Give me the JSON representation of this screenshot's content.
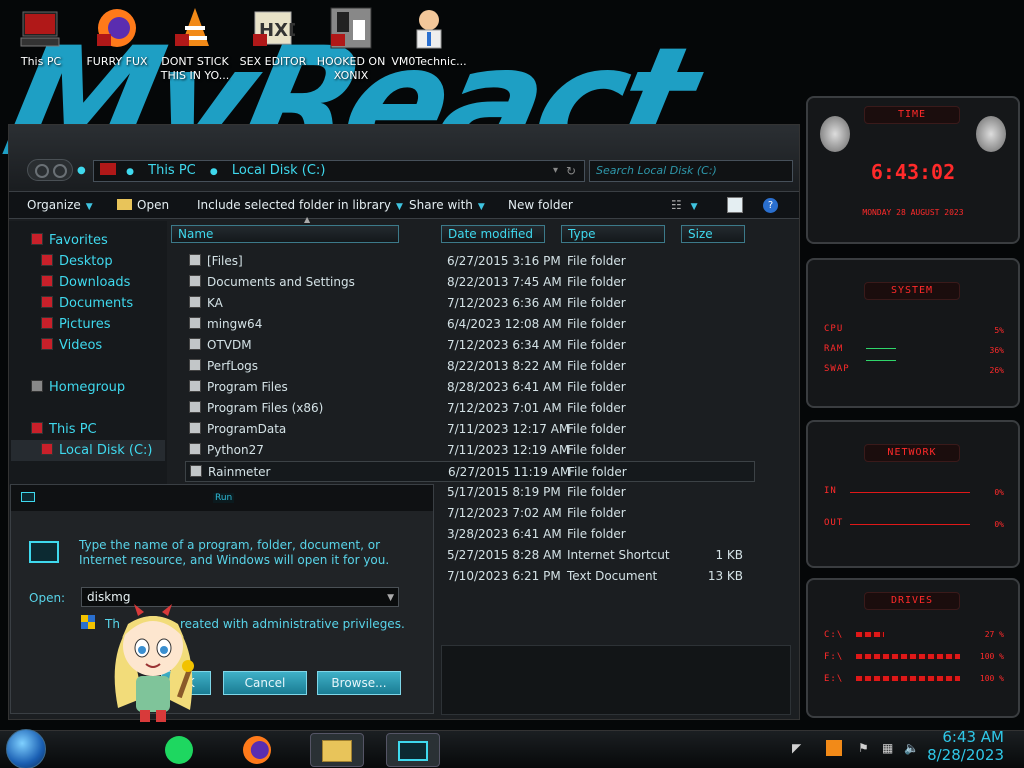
{
  "desktop": {
    "icons": [
      {
        "label": "This PC"
      },
      {
        "label": "FURRY FUX"
      },
      {
        "label": "DONT STICK THIS IN YO..."
      },
      {
        "label": "SEX EDITOR"
      },
      {
        "label": "HOOKED ON XONIX"
      },
      {
        "label": "VM0Technic..."
      }
    ]
  },
  "explorer": {
    "breadcrumb": [
      "This PC",
      "Local Disk (C:)"
    ],
    "search_placeholder": "Search Local Disk (C:)",
    "toolbar": {
      "organize": "Organize",
      "open": "Open",
      "include": "Include selected folder in library",
      "share": "Share with",
      "new_folder": "New folder"
    },
    "nav": {
      "favorites": "Favorites",
      "desktop": "Desktop",
      "downloads": "Downloads",
      "documents": "Documents",
      "pictures": "Pictures",
      "videos": "Videos",
      "homegroup": "Homegroup",
      "this_pc": "This PC",
      "local_disk": "Local Disk (C:)"
    },
    "columns": {
      "name": "Name",
      "date": "Date modified",
      "type": "Type",
      "size": "Size"
    },
    "rows": [
      {
        "name": "[Files]",
        "date": "6/27/2015 3:16 PM",
        "type": "File folder",
        "size": ""
      },
      {
        "name": "Documents and Settings",
        "date": "8/22/2013 7:45 AM",
        "type": "File folder",
        "size": ""
      },
      {
        "name": "KA",
        "date": "7/12/2023 6:36 AM",
        "type": "File folder",
        "size": ""
      },
      {
        "name": "mingw64",
        "date": "6/4/2023 12:08 AM",
        "type": "File folder",
        "size": ""
      },
      {
        "name": "OTVDM",
        "date": "7/12/2023 6:34 AM",
        "type": "File folder",
        "size": ""
      },
      {
        "name": "PerfLogs",
        "date": "8/22/2013 8:22 AM",
        "type": "File folder",
        "size": ""
      },
      {
        "name": "Program Files",
        "date": "8/28/2023 6:41 AM",
        "type": "File folder",
        "size": ""
      },
      {
        "name": "Program Files (x86)",
        "date": "7/12/2023 7:01 AM",
        "type": "File folder",
        "size": ""
      },
      {
        "name": "ProgramData",
        "date": "7/11/2023 12:17 AM",
        "type": "File folder",
        "size": ""
      },
      {
        "name": "Python27",
        "date": "7/11/2023 12:19 AM",
        "type": "File folder",
        "size": ""
      },
      {
        "name": "Rainmeter",
        "date": "6/27/2015 11:19 AM",
        "type": "File folder",
        "size": ""
      },
      {
        "name": "",
        "date": "5/17/2015 8:19 PM",
        "type": "File folder",
        "size": ""
      },
      {
        "name": "",
        "date": "7/12/2023 7:02 AM",
        "type": "File folder",
        "size": ""
      },
      {
        "name": "",
        "date": "3/28/2023 6:41 AM",
        "type": "File folder",
        "size": ""
      },
      {
        "name": "",
        "date": "5/27/2015 8:28 AM",
        "type": "Internet Shortcut",
        "size": "1 KB"
      },
      {
        "name": "",
        "date": "7/10/2023 6:21 PM",
        "type": "Text Document",
        "size": "13 KB"
      }
    ]
  },
  "run_dialog": {
    "title": "Run",
    "description": "Type the name of a program, folder, document, or Internet resource, and Windows will open it for you.",
    "open_label": "Open:",
    "input_value": "diskmg",
    "admin_note_start": "Th",
    "admin_note_end": "reated with administrative privileges.",
    "ok": "OK",
    "cancel": "Cancel",
    "browse": "Browse..."
  },
  "rainmeter": {
    "time": {
      "header": "TIME",
      "clock": "6:43:02",
      "date": "MONDAY 28 AUGUST 2023"
    },
    "system": {
      "header": "SYSTEM",
      "cpu_label": "CPU",
      "cpu": "5%",
      "ram_label": "RAM",
      "ram": "36%",
      "swap_label": "SWAP",
      "swap": "26%"
    },
    "network": {
      "header": "NETWORK",
      "in_label": "IN",
      "in": "0%",
      "out_label": "OUT",
      "out": "0%"
    },
    "drives": {
      "header": "DRIVES",
      "items": [
        {
          "label": "C:\\",
          "value": "27 %",
          "fill": 0.27
        },
        {
          "label": "F:\\",
          "value": "100 %",
          "fill": 1.0
        },
        {
          "label": "E:\\",
          "value": "100 %",
          "fill": 1.0
        }
      ]
    }
  },
  "taskbar": {
    "time": "6:43 AM",
    "date": "8/28/2023"
  },
  "colors": {
    "accent": "#3fd9ee",
    "meter": "#ff2a2a",
    "wallpaper_text": "#1e9fc4"
  }
}
